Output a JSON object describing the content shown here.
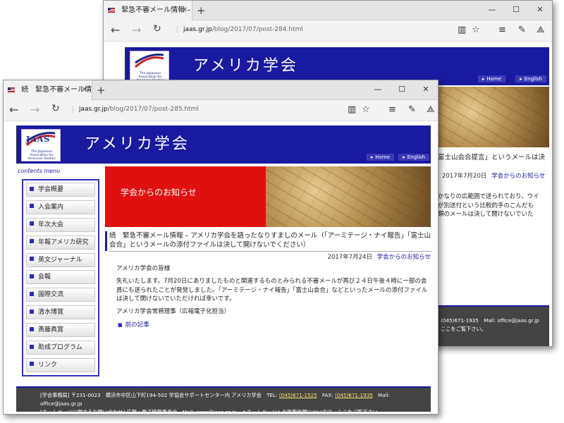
{
  "back_window": {
    "tab_title": "緊急不審メール情報 – ",
    "url_domain": "jaas.gr.jp",
    "url_path": "/blog/2017/07/post-284.html",
    "site_title": "アメリカ学会",
    "nav_home": "Home",
    "nav_english": "English",
    "title_fragment": "富士山会合提言」というメールは決",
    "date": "2017年7月20日",
    "category": "学会からのお知らせ",
    "excerpt_1": "かなりの広範囲で送られており、ウイ",
    "excerpt_2": "が別送付という比較的手のこんだも",
    "excerpt_3": "類のメールは決して開けないでいた",
    "footer_line1": "(045)671-1935　Mail: office@jaas.gr.jp",
    "footer_line2": "ここをご覧下さい。"
  },
  "front_window": {
    "tab_title": "続　緊急不審メール情報",
    "url_domain": "jaas.gr.jp",
    "url_path": "/blog/2017/07/post-285.html",
    "site_title": "アメリカ学会",
    "logo_text": "JAAS",
    "logo_subtitle": "The Japanese Association for American Studies",
    "nav_home": "Home",
    "nav_english": "English",
    "sidebar_title": "contents menu",
    "menu": [
      "学会概要",
      "入会案内",
      "年次大会",
      "年報アメリカ研究",
      "英文ジャーナル",
      "会報",
      "国際交流",
      "清水博賞",
      "斎藤眞賞",
      "助成プログラム",
      "リンク"
    ],
    "banner_text": "学会からのお知らせ",
    "post_title": "続　緊急不審メール情報 – アメリカ学会を語ったなりすましのメール（「アーミテージ・ナイ報告」「富士山会合」というメールの添付ファイルは決して開けないでください）",
    "date": "2017年7月24日",
    "category": "学会からのお知らせ",
    "greeting": "アメリカ学会の皆様",
    "paragraph": "失礼いたします。7月20日にありましたものと関連するものとみられる不審メールが再び２４日午後４時に一部の会員にも送られたことが発覚しました。「アーミテージ・ナイ報告」「富士山会合」などといったメールの添付ファイルは決して開けないでいただければ幸いです。",
    "signature": "アメリカ学会常務理事（広報電子化担当）",
    "prev_link": "前の記事",
    "footer_line1_a": "[学会事務局] 〒231-0023　横浜市中区山下町194-502 学協会サポートセンター内 アメリカ学会　TEL: ",
    "footer_tel": "(045)671-1525",
    "footer_line1_b": "　FAX: ",
    "footer_fax": "(045)671-1935",
    "footer_line1_c": "　Mail: office@jaas.gr.jp",
    "footer_line2": "[ホームページに関するお問い合わせ] 広報・電子情報委員会　Mail: www@jaas.gr.jp　＊ホームページへの掲載依頼については、ここをご覧下さい。"
  },
  "colors": {
    "header_blue": "#1a1aa0",
    "banner_red": "#e01010",
    "footer_gray": "#444444"
  },
  "icons": [
    "back-arrow-icon",
    "forward-arrow-icon",
    "refresh-icon",
    "reading-view-icon",
    "favorite-star-icon",
    "hub-icon",
    "web-note-icon",
    "share-icon"
  ]
}
